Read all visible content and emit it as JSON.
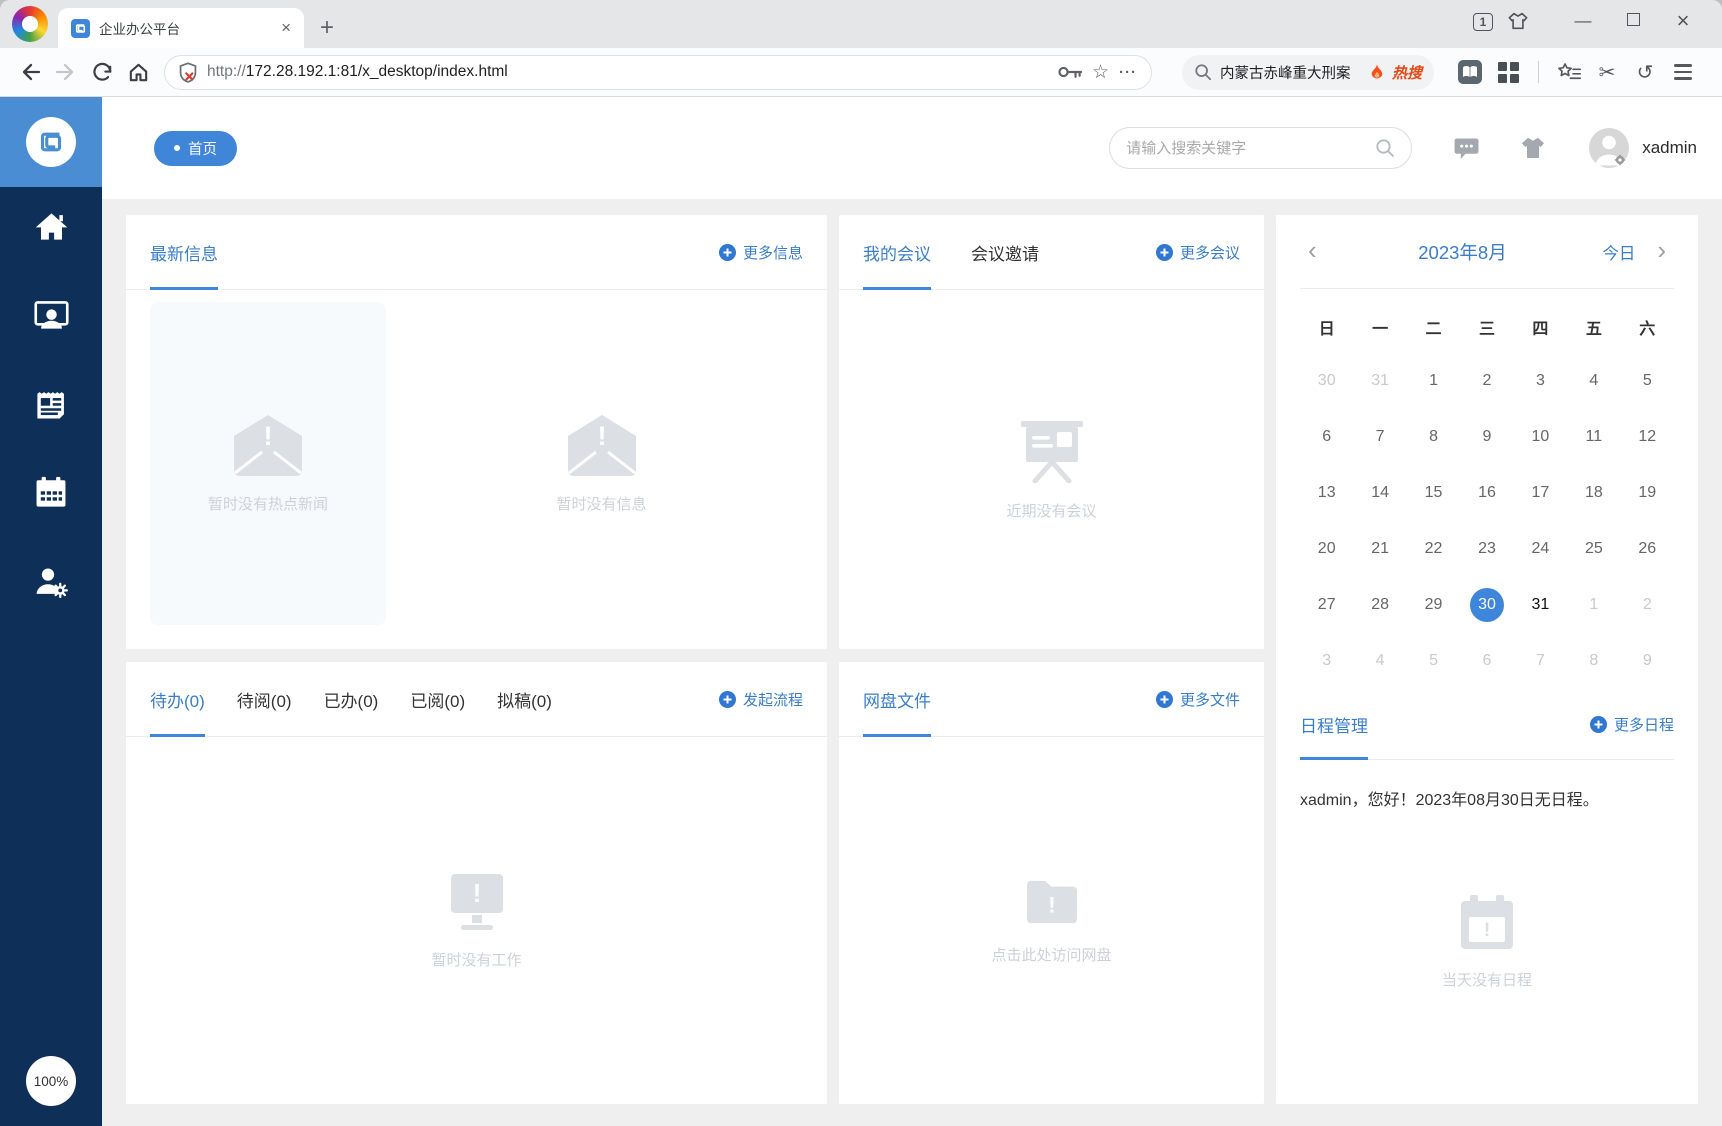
{
  "browser": {
    "tab_title": "企业办公平台",
    "tab_count": "1",
    "url_scheme": "http://",
    "url_rest": "172.28.192.1:81/x_desktop/index.html",
    "hot_search_text": "内蒙古赤峰重大刑案",
    "hot_search_badge": "热搜",
    "star_glyph": "☆",
    "dots_glyph": "···",
    "scissors_glyph": "✂",
    "undo_glyph": "↺",
    "close_glyph": "×",
    "newtab_glyph": "+",
    "minimize_glyph": "—"
  },
  "header": {
    "home_pill": "首页",
    "search_placeholder": "请输入搜索关键字",
    "username": "xadmin"
  },
  "sidebar": {
    "zoom_label": "100%"
  },
  "panels": {
    "news": {
      "title": "最新信息",
      "more": "更多信息",
      "empty_hot": "暂时没有热点新闻",
      "empty_info": "暂时没有信息"
    },
    "meeting": {
      "tabs": [
        "我的会议",
        "会议邀请"
      ],
      "more": "更多会议",
      "empty": "近期没有会议"
    },
    "work": {
      "tabs": [
        "待办(0)",
        "待阅(0)",
        "已办(0)",
        "已阅(0)",
        "拟稿(0)"
      ],
      "action": "发起流程",
      "empty": "暂时没有工作"
    },
    "netdisk": {
      "title": "网盘文件",
      "more": "更多文件",
      "empty": "点击此处访问网盘"
    },
    "schedule": {
      "title": "日程管理",
      "more": "更多日程",
      "greeting": "xadmin，您好！2023年08月30日无日程。",
      "empty": "当天没有日程"
    }
  },
  "calendar": {
    "month_label": "2023年8月",
    "today_label": "今日",
    "prev_glyph": "‹",
    "next_glyph": "›",
    "weekdays": [
      "日",
      "一",
      "二",
      "三",
      "四",
      "五",
      "六"
    ],
    "selected_day": "30",
    "weeks": [
      [
        {
          "d": "30",
          "t": "o"
        },
        {
          "d": "31",
          "t": "o"
        },
        {
          "d": "1",
          "t": "c"
        },
        {
          "d": "2",
          "t": "c"
        },
        {
          "d": "3",
          "t": "c"
        },
        {
          "d": "4",
          "t": "c"
        },
        {
          "d": "5",
          "t": "c"
        }
      ],
      [
        {
          "d": "6",
          "t": "c"
        },
        {
          "d": "7",
          "t": "c"
        },
        {
          "d": "8",
          "t": "c"
        },
        {
          "d": "9",
          "t": "c"
        },
        {
          "d": "10",
          "t": "c"
        },
        {
          "d": "11",
          "t": "c"
        },
        {
          "d": "12",
          "t": "c"
        }
      ],
      [
        {
          "d": "13",
          "t": "c"
        },
        {
          "d": "14",
          "t": "c"
        },
        {
          "d": "15",
          "t": "c"
        },
        {
          "d": "16",
          "t": "c"
        },
        {
          "d": "17",
          "t": "c"
        },
        {
          "d": "18",
          "t": "c"
        },
        {
          "d": "19",
          "t": "c"
        }
      ],
      [
        {
          "d": "20",
          "t": "c"
        },
        {
          "d": "21",
          "t": "c"
        },
        {
          "d": "22",
          "t": "c"
        },
        {
          "d": "23",
          "t": "c"
        },
        {
          "d": "24",
          "t": "c"
        },
        {
          "d": "25",
          "t": "c"
        },
        {
          "d": "26",
          "t": "c"
        }
      ],
      [
        {
          "d": "27",
          "t": "c"
        },
        {
          "d": "28",
          "t": "c"
        },
        {
          "d": "29",
          "t": "c"
        },
        {
          "d": "30",
          "t": "s"
        },
        {
          "d": "31",
          "t": "b"
        },
        {
          "d": "1",
          "t": "o"
        },
        {
          "d": "2",
          "t": "o"
        }
      ],
      [
        {
          "d": "3",
          "t": "o"
        },
        {
          "d": "4",
          "t": "o"
        },
        {
          "d": "5",
          "t": "o"
        },
        {
          "d": "6",
          "t": "o"
        },
        {
          "d": "7",
          "t": "o"
        },
        {
          "d": "8",
          "t": "o"
        },
        {
          "d": "9",
          "t": "o"
        }
      ]
    ]
  },
  "colors": {
    "accent": "#3a7dc9",
    "sidebar": "#0e2f58",
    "logo_block": "#4a8dd3",
    "selected_day": "#3e86d9"
  }
}
